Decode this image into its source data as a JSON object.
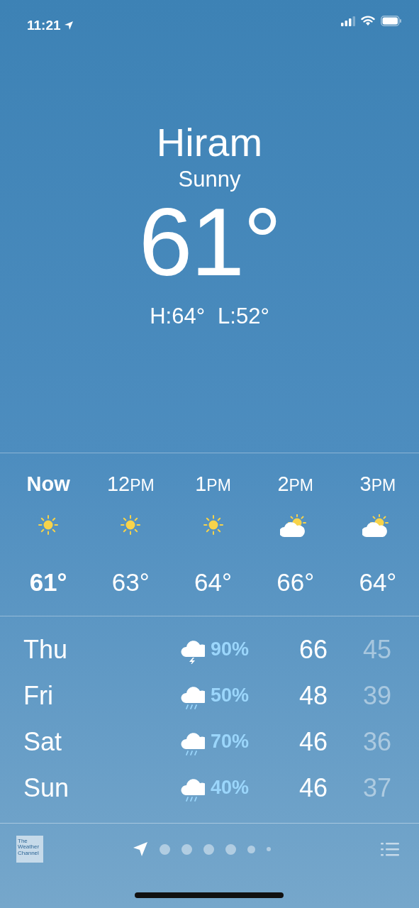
{
  "status_bar": {
    "time": "11:21",
    "location_on": true
  },
  "header": {
    "city": "Hiram",
    "condition": "Sunny",
    "temperature": "61°",
    "high": "H:64°",
    "low": "L:52°"
  },
  "hourly": [
    {
      "hour": "Now",
      "now": true,
      "kind": "sun",
      "temp": "61°"
    },
    {
      "hour": "12",
      "period": "PM",
      "now": false,
      "kind": "sun",
      "temp": "63°"
    },
    {
      "hour": "1",
      "period": "PM",
      "now": false,
      "kind": "sun",
      "temp": "64°"
    },
    {
      "hour": "2",
      "period": "PM",
      "now": false,
      "kind": "partly-cloudy",
      "temp": "66°"
    },
    {
      "hour": "3",
      "period": "PM",
      "now": false,
      "kind": "partly-cloudy",
      "temp": "64°"
    }
  ],
  "daily": [
    {
      "day": "Thu",
      "kind": "thunder",
      "chance": "90%",
      "high": "66",
      "low": "45"
    },
    {
      "day": "Fri",
      "kind": "rain",
      "chance": "50%",
      "high": "48",
      "low": "39"
    },
    {
      "day": "Sat",
      "kind": "rain",
      "chance": "70%",
      "high": "46",
      "low": "36"
    },
    {
      "day": "Sun",
      "kind": "rain",
      "chance": "40%",
      "high": "46",
      "low": "37"
    }
  ],
  "toolbar": {
    "logo": "The Weather Channel",
    "pages": [
      {
        "kind": "location",
        "selected": true
      },
      {
        "kind": "dot",
        "selected": false
      },
      {
        "kind": "dot",
        "selected": false
      },
      {
        "kind": "dot",
        "selected": false
      },
      {
        "kind": "dot",
        "selected": false
      },
      {
        "kind": "small",
        "selected": false
      },
      {
        "kind": "tiny",
        "selected": false
      }
    ]
  }
}
